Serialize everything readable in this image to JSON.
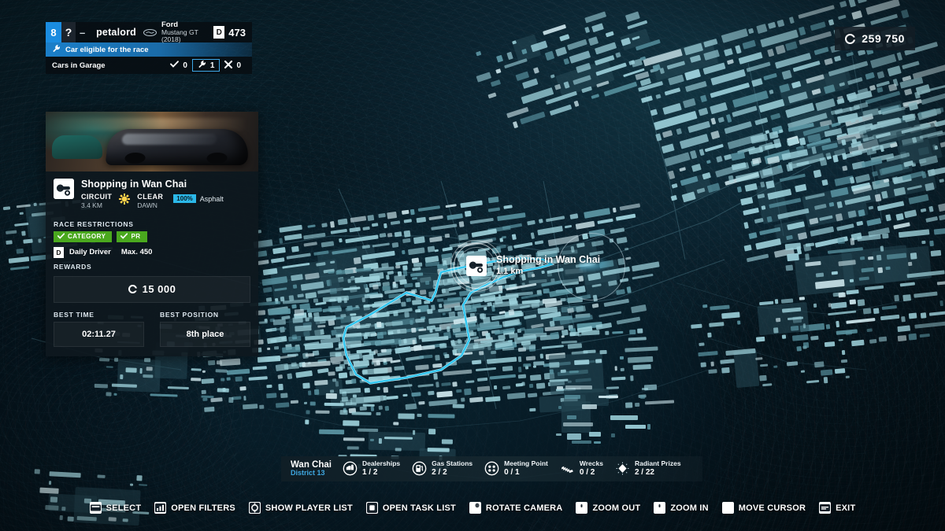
{
  "player": {
    "rank": "8",
    "unknown_marker": "?",
    "dash": "–",
    "name": "petalord",
    "brand_icon": "ford-oval-icon",
    "car_make": "Ford",
    "car_model": "Mustang GT (2018)",
    "class_letter": "D",
    "class_rating": "473",
    "eligible_text": "Car eligible for the race",
    "eligible_icon": "wrench-icon",
    "garage_label": "Cars in Garage",
    "garage_stats": [
      {
        "icon": "check-icon",
        "value": "0"
      },
      {
        "icon": "wrench-icon",
        "value": "1"
      },
      {
        "icon": "cross-icon",
        "value": "0"
      }
    ]
  },
  "currency": {
    "icon": "credits-coin-icon",
    "value": "259 750"
  },
  "race_card": {
    "title": "Shopping in Wan Chai",
    "type_icon": "circuit-icon",
    "type": "CIRCUIT",
    "length": "3.4 KM",
    "weather_icon": "sun-icon",
    "weather": "CLEAR",
    "time_of_day": "DAWN",
    "surface_pct": "100%",
    "surface_name": "Asphalt",
    "restrictions_label": "RACE RESTRICTIONS",
    "chips": [
      {
        "icon": "check-icon",
        "label": "CATEGORY"
      },
      {
        "icon": "check-icon",
        "label": "PR"
      }
    ],
    "restriction_badge": "D",
    "restriction_name": "Daily Driver",
    "restriction_max": "Max. 450",
    "rewards_label": "REWARDS",
    "reward_icon": "credits-coin-icon",
    "reward_value": "15 000",
    "best_time_label": "BEST TIME",
    "best_time_value": "02:11.27",
    "best_position_label": "BEST POSITION",
    "best_position_value": "8th place"
  },
  "map_marker": {
    "icon": "circuit-icon",
    "title": "Shopping in Wan Chai",
    "distance": "1.1 km"
  },
  "district": {
    "name": "Wan Chai",
    "sub": "District 13",
    "items": [
      {
        "icon": "dealership-icon",
        "label": "Dealerships",
        "count": "1 / 2"
      },
      {
        "icon": "gas-station-icon",
        "label": "Gas Stations",
        "count": "2 / 2"
      },
      {
        "icon": "meeting-point-icon",
        "label": "Meeting Point",
        "count": "0 / 1"
      },
      {
        "icon": "wreck-icon",
        "label": "Wrecks",
        "count": "0 / 2"
      },
      {
        "icon": "radiant-prize-icon",
        "label": "Radiant Prizes",
        "count": "2 / 22"
      }
    ]
  },
  "hints": [
    {
      "icon": "key-enter-icon",
      "label": "SELECT"
    },
    {
      "icon": "key-filters-icon",
      "label": "OPEN FILTERS"
    },
    {
      "icon": "key-player-list-icon",
      "label": "SHOW PLAYER LIST"
    },
    {
      "icon": "key-task-list-icon",
      "label": "OPEN TASK LIST"
    },
    {
      "icon": "key-mouse-icon",
      "label": "ROTATE CAMERA"
    },
    {
      "icon": "key-mouse-scroll-icon",
      "label": "ZOOM OUT"
    },
    {
      "icon": "key-mouse-scroll-icon",
      "label": "ZOOM IN"
    },
    {
      "icon": "key-dpad-icon",
      "label": "MOVE CURSOR"
    },
    {
      "icon": "key-esc-icon",
      "label": "EXIT"
    }
  ],
  "colors": {
    "accent_blue": "#1a8ce0",
    "route_cyan": "#2fc6f0",
    "chip_green": "#4aa81e",
    "district_sub": "#3fa7e0",
    "map_dark": "#061620",
    "building": "#9fd3dd"
  }
}
